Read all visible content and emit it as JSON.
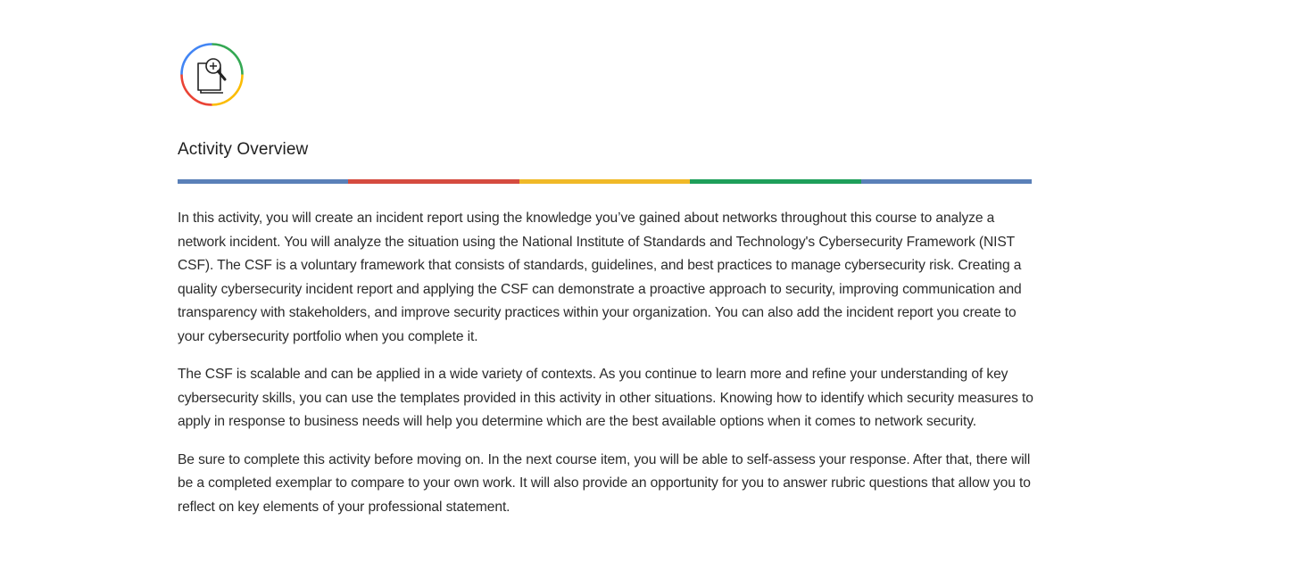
{
  "icon": {
    "name": "document-magnifier-icon",
    "ring_colors": [
      "#4285f4",
      "#34a853",
      "#fbbc04",
      "#ea4335"
    ]
  },
  "overview": {
    "title": "Activity Overview",
    "divider_colors": [
      "#5a80b8",
      "#d54b3f",
      "#f0b928",
      "#1e9f5a",
      "#5a80b8"
    ],
    "paragraphs": [
      "In this activity, you will create an incident report using the knowledge you’ve gained about networks throughout this course to analyze a network incident. You will analyze the situation using the National Institute of Standards and Technology's Cybersecurity Framework (NIST CSF). The CSF is a voluntary framework that consists of standards, guidelines, and best practices to manage cybersecurity risk. Creating a quality cybersecurity incident report and applying the CSF can demonstrate a proactive approach to security, improving communication and transparency with stakeholders, and improve security practices within your organization. You can also add the incident report you create to your cybersecurity portfolio when  you complete it.",
      "The CSF is scalable and can be applied in a wide variety of contexts. As you continue to learn more and refine your understanding of key cybersecurity skills, you can use the templates provided in this activity in other situations. Knowing how to identify which security measures to apply in response to business needs will help you determine which are the best available options when it comes to network security.",
      "Be sure to complete this activity before moving on. In the next course item, you will be able to self-assess your response. After that, there will be a completed exemplar to compare to your own work. It will also provide an opportunity for you to answer rubric questions that allow you to reflect on key elements of your professional statement."
    ]
  }
}
